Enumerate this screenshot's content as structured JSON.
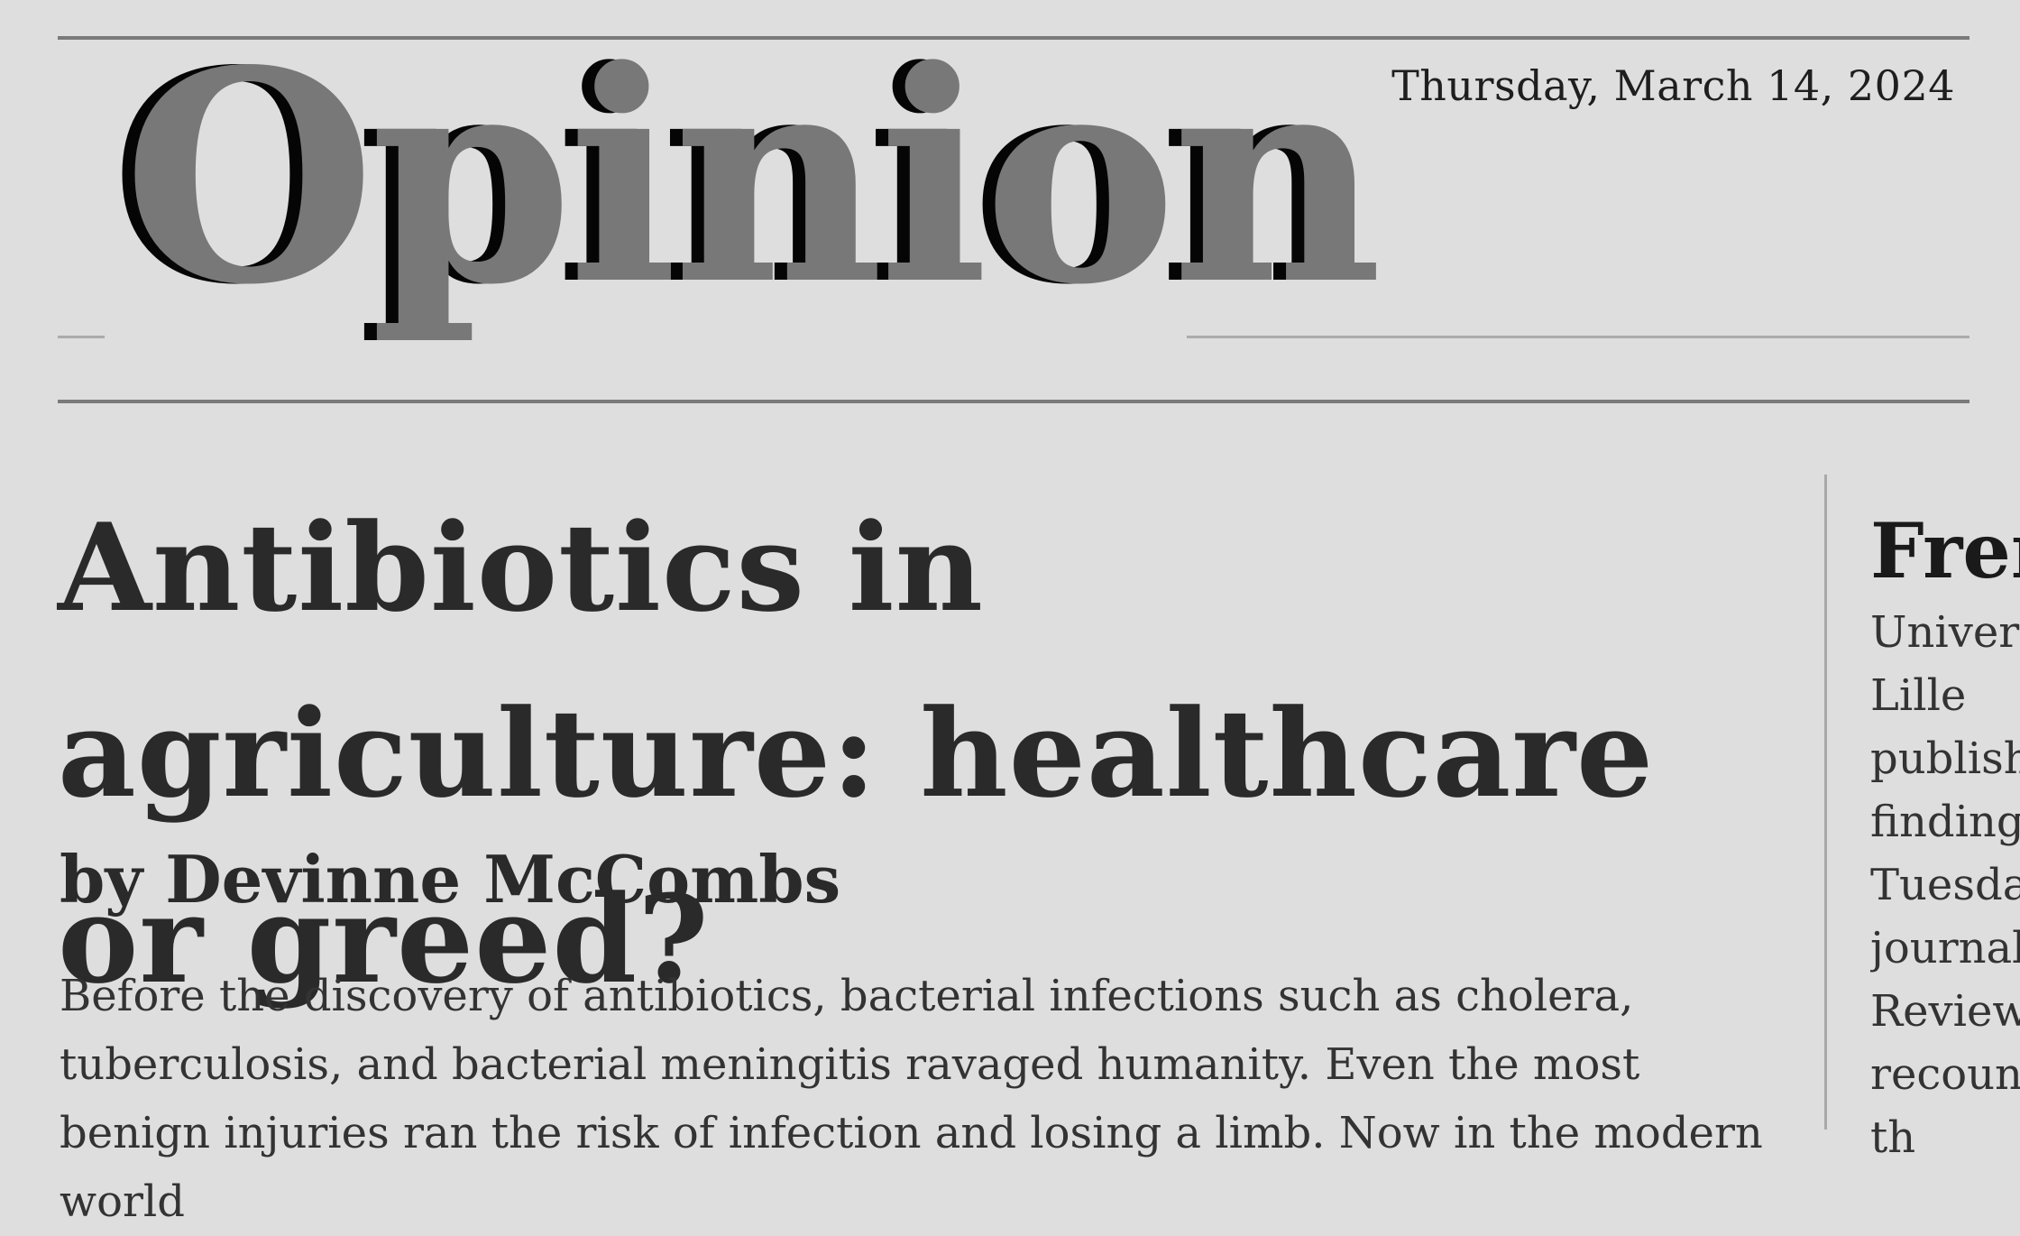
{
  "header": {
    "section_title": "Opinion",
    "date": "Thursday, March 14, 2024"
  },
  "article": {
    "headline": "Antibiotics in agriculture: healthcare or greed?",
    "byline": "by Devinne McCombs",
    "body": "Before the discovery of antibiotics, bacterial infections such as cholera, tuberculosis, and bacterial meningitis ravaged humanity. Even the most benign injuries ran the risk of infection and losing a limb. Now in the modern world"
  },
  "sidebar": {
    "title": "Fren",
    "lines": [
      "Univers",
      "Lille",
      "publishe",
      "findings",
      "Tuesday",
      "journal",
      "Review",
      "recounti",
      "th"
    ]
  }
}
